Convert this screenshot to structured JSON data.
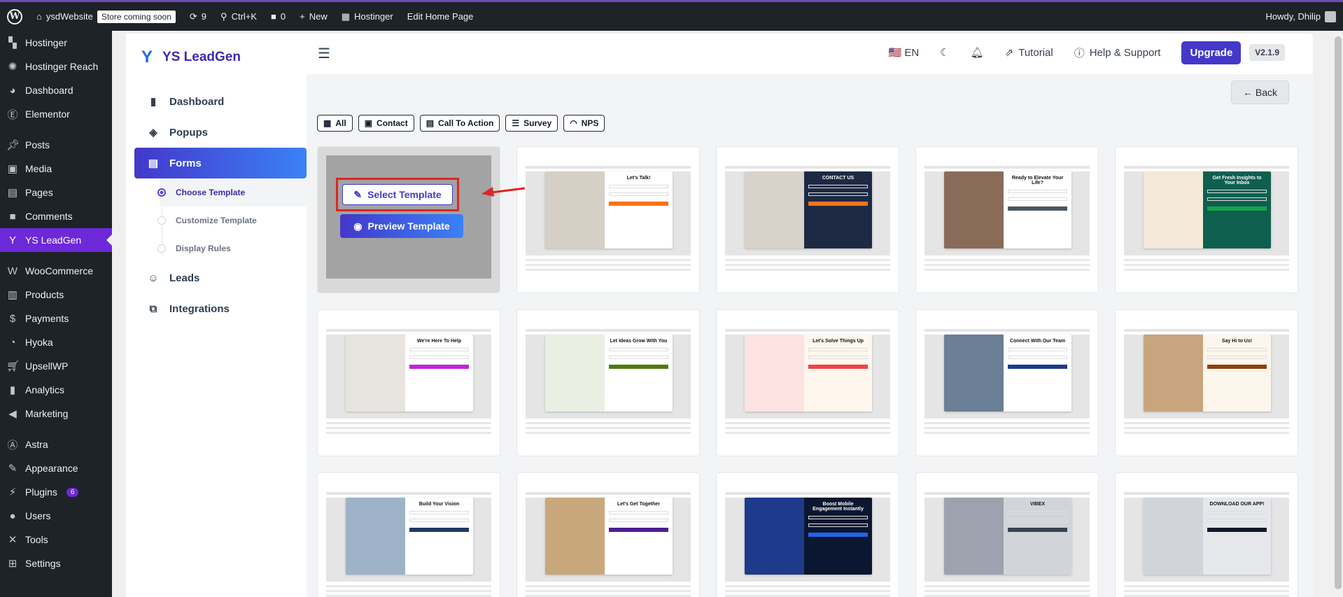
{
  "adminbar": {
    "site_name": "ysdWebsite",
    "store_badge": "Store coming soon",
    "updates": "9",
    "search_shortcut": "Ctrl+K",
    "comments": "0",
    "new": "New",
    "hostinger": "Hostinger",
    "edit_page": "Edit Home Page",
    "howdy": "Howdy, Dhilip"
  },
  "wpmenu": {
    "items": [
      {
        "label": "Hostinger",
        "icon": "hostinger-icon"
      },
      {
        "label": "Hostinger Reach",
        "icon": "reach-icon"
      },
      {
        "label": "Dashboard",
        "icon": "dashboard-icon"
      },
      {
        "label": "Elementor",
        "icon": "elementor-icon"
      },
      {
        "label": "Posts",
        "icon": "pin-icon"
      },
      {
        "label": "Media",
        "icon": "media-icon"
      },
      {
        "label": "Pages",
        "icon": "pages-icon"
      },
      {
        "label": "Comments",
        "icon": "comment-icon"
      },
      {
        "label": "YS LeadGen",
        "icon": "leadgen-icon"
      },
      {
        "label": "WooCommerce",
        "icon": "woo-icon"
      },
      {
        "label": "Products",
        "icon": "archive-icon"
      },
      {
        "label": "Payments",
        "icon": "dollar-icon"
      },
      {
        "label": "Hyoka",
        "icon": "hyoka-icon"
      },
      {
        "label": "UpsellWP",
        "icon": "cart-icon"
      },
      {
        "label": "Analytics",
        "icon": "bar-chart-icon"
      },
      {
        "label": "Marketing",
        "icon": "megaphone-icon"
      },
      {
        "label": "Astra",
        "icon": "astra-icon"
      },
      {
        "label": "Appearance",
        "icon": "brush-icon"
      },
      {
        "label": "Plugins",
        "icon": "plug-icon",
        "count": "6"
      },
      {
        "label": "Users",
        "icon": "user-icon"
      },
      {
        "label": "Tools",
        "icon": "wrench-icon"
      },
      {
        "label": "Settings",
        "icon": "settings-icon"
      }
    ]
  },
  "brand": {
    "name": "YS LeadGen"
  },
  "nav": {
    "dashboard": "Dashboard",
    "popups": "Popups",
    "forms": "Forms",
    "sub": [
      "Choose Template",
      "Customize Template",
      "Display Rules"
    ],
    "leads": "Leads",
    "integrations": "Integrations"
  },
  "topbar": {
    "lang": "🇺🇸 EN",
    "tutorial": "Tutorial",
    "help": "Help & Support",
    "upgrade": "Upgrade",
    "version": "V2.1.9"
  },
  "content": {
    "back": "← Back",
    "filters": [
      "All",
      "Contact",
      "Call To Action",
      "Survey",
      "NPS"
    ],
    "select_template": "Select Template",
    "preview_template": "Preview Template"
  },
  "templates": [
    {
      "heading": "",
      "form_color": "#ffffff",
      "img_color": "#bdbdbd"
    },
    {
      "heading": "Let's Talk!",
      "form_color": "#ffffff",
      "img_color": "#d6cfc6",
      "btn": "#f97316"
    },
    {
      "heading": "CONTACT US",
      "form_color": "#1e2a44",
      "img_color": "#d8d2ca",
      "btn": "#f97316"
    },
    {
      "heading": "Ready to Elevate Your Life?",
      "form_color": "#ffffff",
      "img_color": "#8a6b5a",
      "btn": "#4b5563"
    },
    {
      "heading": "Get Fresh Insights to Your Inbox",
      "form_color": "#0f5f4f",
      "img_color": "#f4e9d8",
      "btn": "#16a34a"
    },
    {
      "heading": "We're Here To Help",
      "form_color": "#ffffff",
      "img_color": "#e7e3de",
      "btn": "#c026d3"
    },
    {
      "heading": "Let Ideas Grow With You",
      "form_color": "#ffffff",
      "img_color": "#e9efe3",
      "btn": "#4d7c0f"
    },
    {
      "heading": "Let's Solve Things Up",
      "form_color": "#fff7ed",
      "img_color": "#fde2e2",
      "btn": "#ef4444"
    },
    {
      "heading": "Connect With Our Team",
      "form_color": "#ffffff",
      "img_color": "#6b7f95",
      "btn": "#1e3a8a"
    },
    {
      "heading": "Say Hi to Us!",
      "form_color": "#fdf6ec",
      "img_color": "#c8a57f",
      "btn": "#92400e"
    },
    {
      "heading": "Build Your Vision",
      "form_color": "#ffffff",
      "img_color": "#9fb3c8",
      "btn": "#1e3a5f"
    },
    {
      "heading": "Let's Get Together",
      "form_color": "#ffffff",
      "img_color": "#c9a77c",
      "btn": "#4c1d95"
    },
    {
      "heading": "Boost Mobile Engagement Instantly",
      "form_color": "#0b1630",
      "img_color": "#1e3a8a",
      "btn": "#2563eb"
    },
    {
      "heading": "VIBEX",
      "form_color": "#d1d5db",
      "img_color": "#9ca3af",
      "btn": "#374151"
    },
    {
      "heading": "DOWNLOAD OUR APP!",
      "form_color": "#e5e7eb",
      "img_color": "#d1d5db",
      "btn": "#111827"
    }
  ]
}
